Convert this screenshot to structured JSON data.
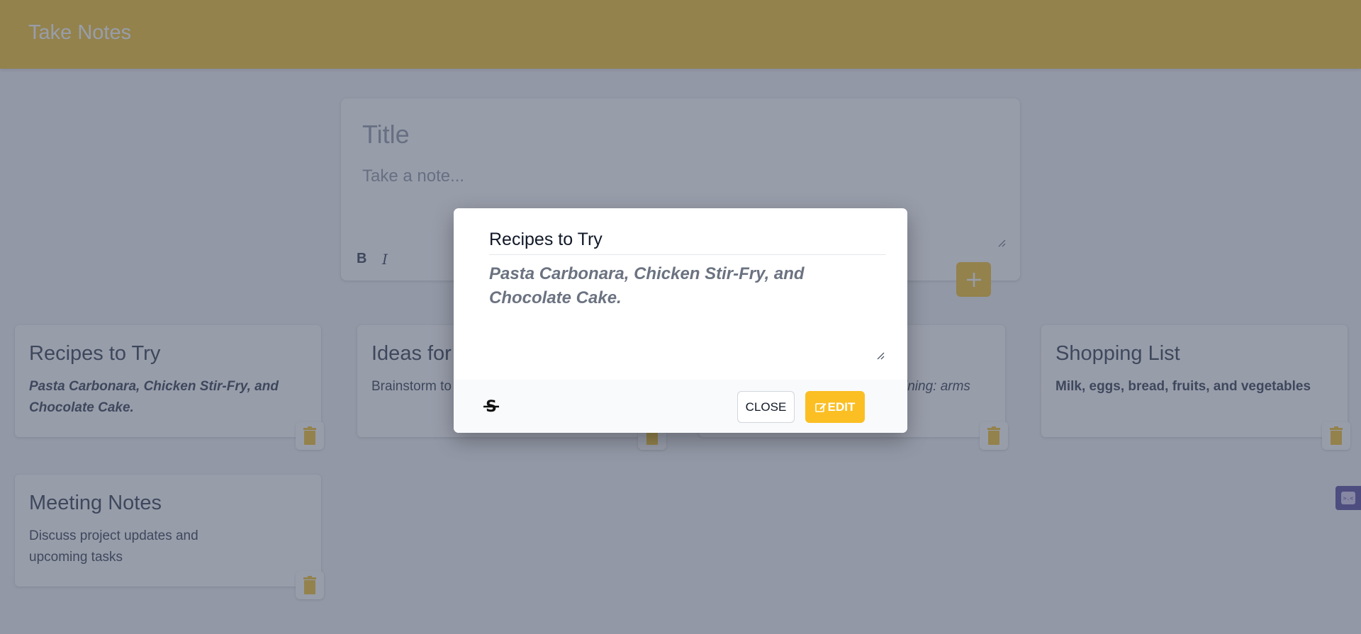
{
  "header": {
    "title": "Take Notes"
  },
  "create_form": {
    "title_placeholder": "Title",
    "body_placeholder": "Take a note...",
    "bold_label": "B",
    "italic_label": "I"
  },
  "notes": [
    {
      "title": "Recipes to Try",
      "body": "Pasta Carbonara, Chicken Stir-Fry, and Chocolate Cake.",
      "style": "bold-italic"
    },
    {
      "title": "Ideas for",
      "body": "Brainstorm to",
      "style": "normal"
    },
    {
      "title": "",
      "body": "ining: arms",
      "style": "italic"
    },
    {
      "title": "Shopping List",
      "body": "Milk, eggs, bread, fruits, and vegetables",
      "style": "bold"
    },
    {
      "title": "Meeting Notes",
      "body": "Discuss project updates and upcoming tasks",
      "style": "normal"
    }
  ],
  "modal": {
    "title": "Recipes to Try",
    "body": "Pasta Carbonara, Chicken Stir-Fry, and Chocolate Cake.",
    "close_label": "CLOSE",
    "edit_label": "EDIT"
  },
  "colors": {
    "header_bg": "#f5c842",
    "accent": "#fbbf24",
    "overlay": "rgba(50,60,85,0.5)"
  },
  "icons": [
    "plus-icon",
    "trash-icon",
    "strikethrough-icon",
    "edit-icon",
    "widget-icon"
  ]
}
